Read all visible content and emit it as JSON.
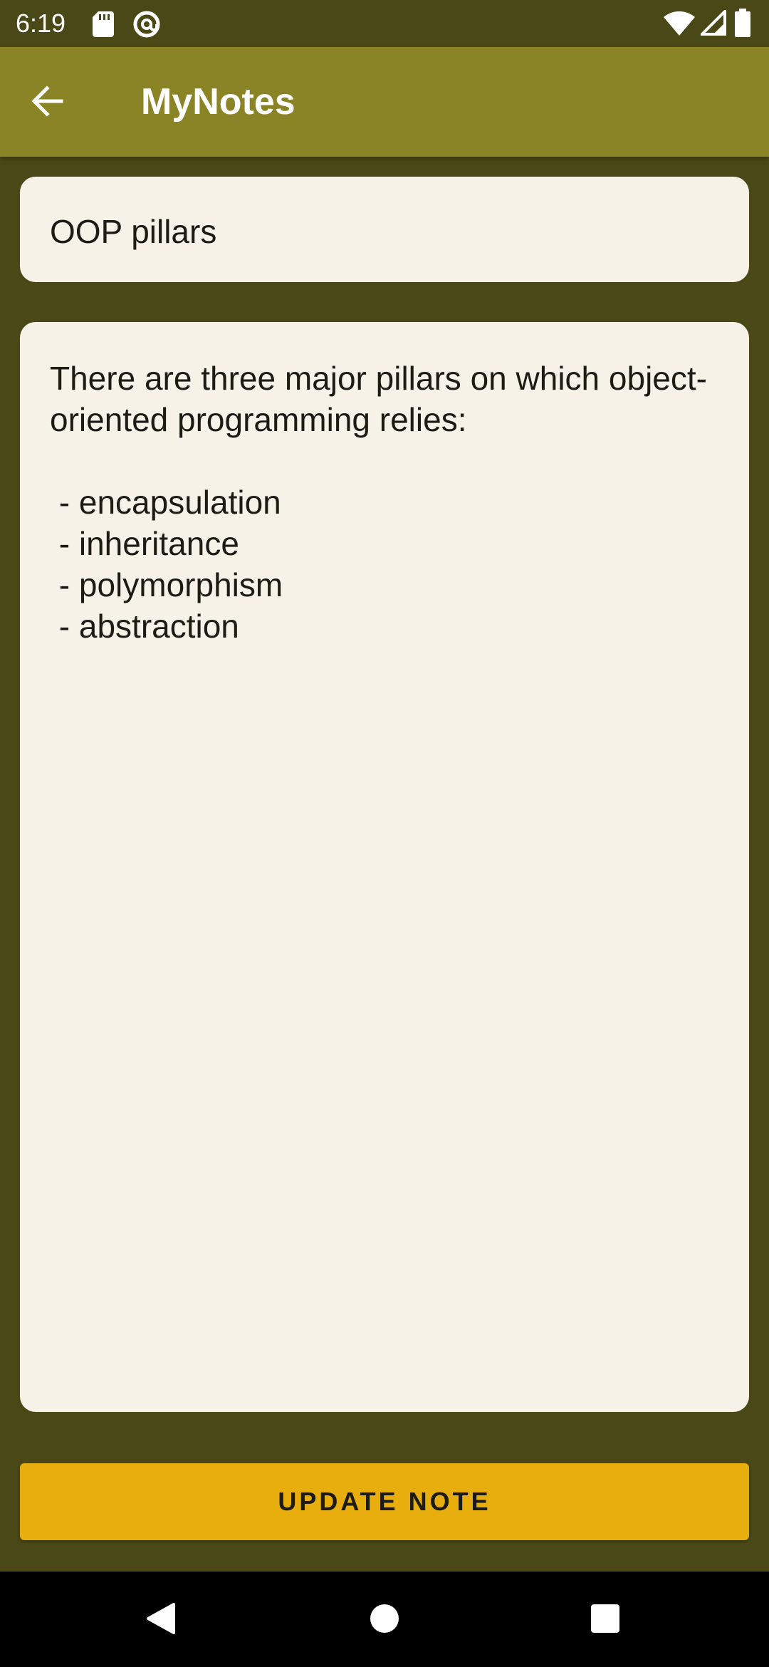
{
  "status_bar": {
    "time": "6:19",
    "icons": [
      "sd-card-icon",
      "at-sign-icon",
      "wifi-icon",
      "signal-icon",
      "battery-icon"
    ]
  },
  "app_bar": {
    "title": "MyNotes",
    "back_icon": "arrow-left-icon"
  },
  "note": {
    "title": "OOP pillars",
    "body": "There are three major pillars on which object-oriented programming relies:\n\n - encapsulation\n - inheritance\n - polymorphism\n - abstraction"
  },
  "actions": {
    "update_label": "UPDATE NOTE"
  },
  "nav_bar": {
    "buttons": [
      "back-triangle-icon",
      "home-circle-icon",
      "recents-square-icon"
    ]
  },
  "colors": {
    "background": "#4a4816",
    "app_bar": "#8a8426",
    "field": "#f7f2e8",
    "accent_button": "#e8ae0e"
  }
}
